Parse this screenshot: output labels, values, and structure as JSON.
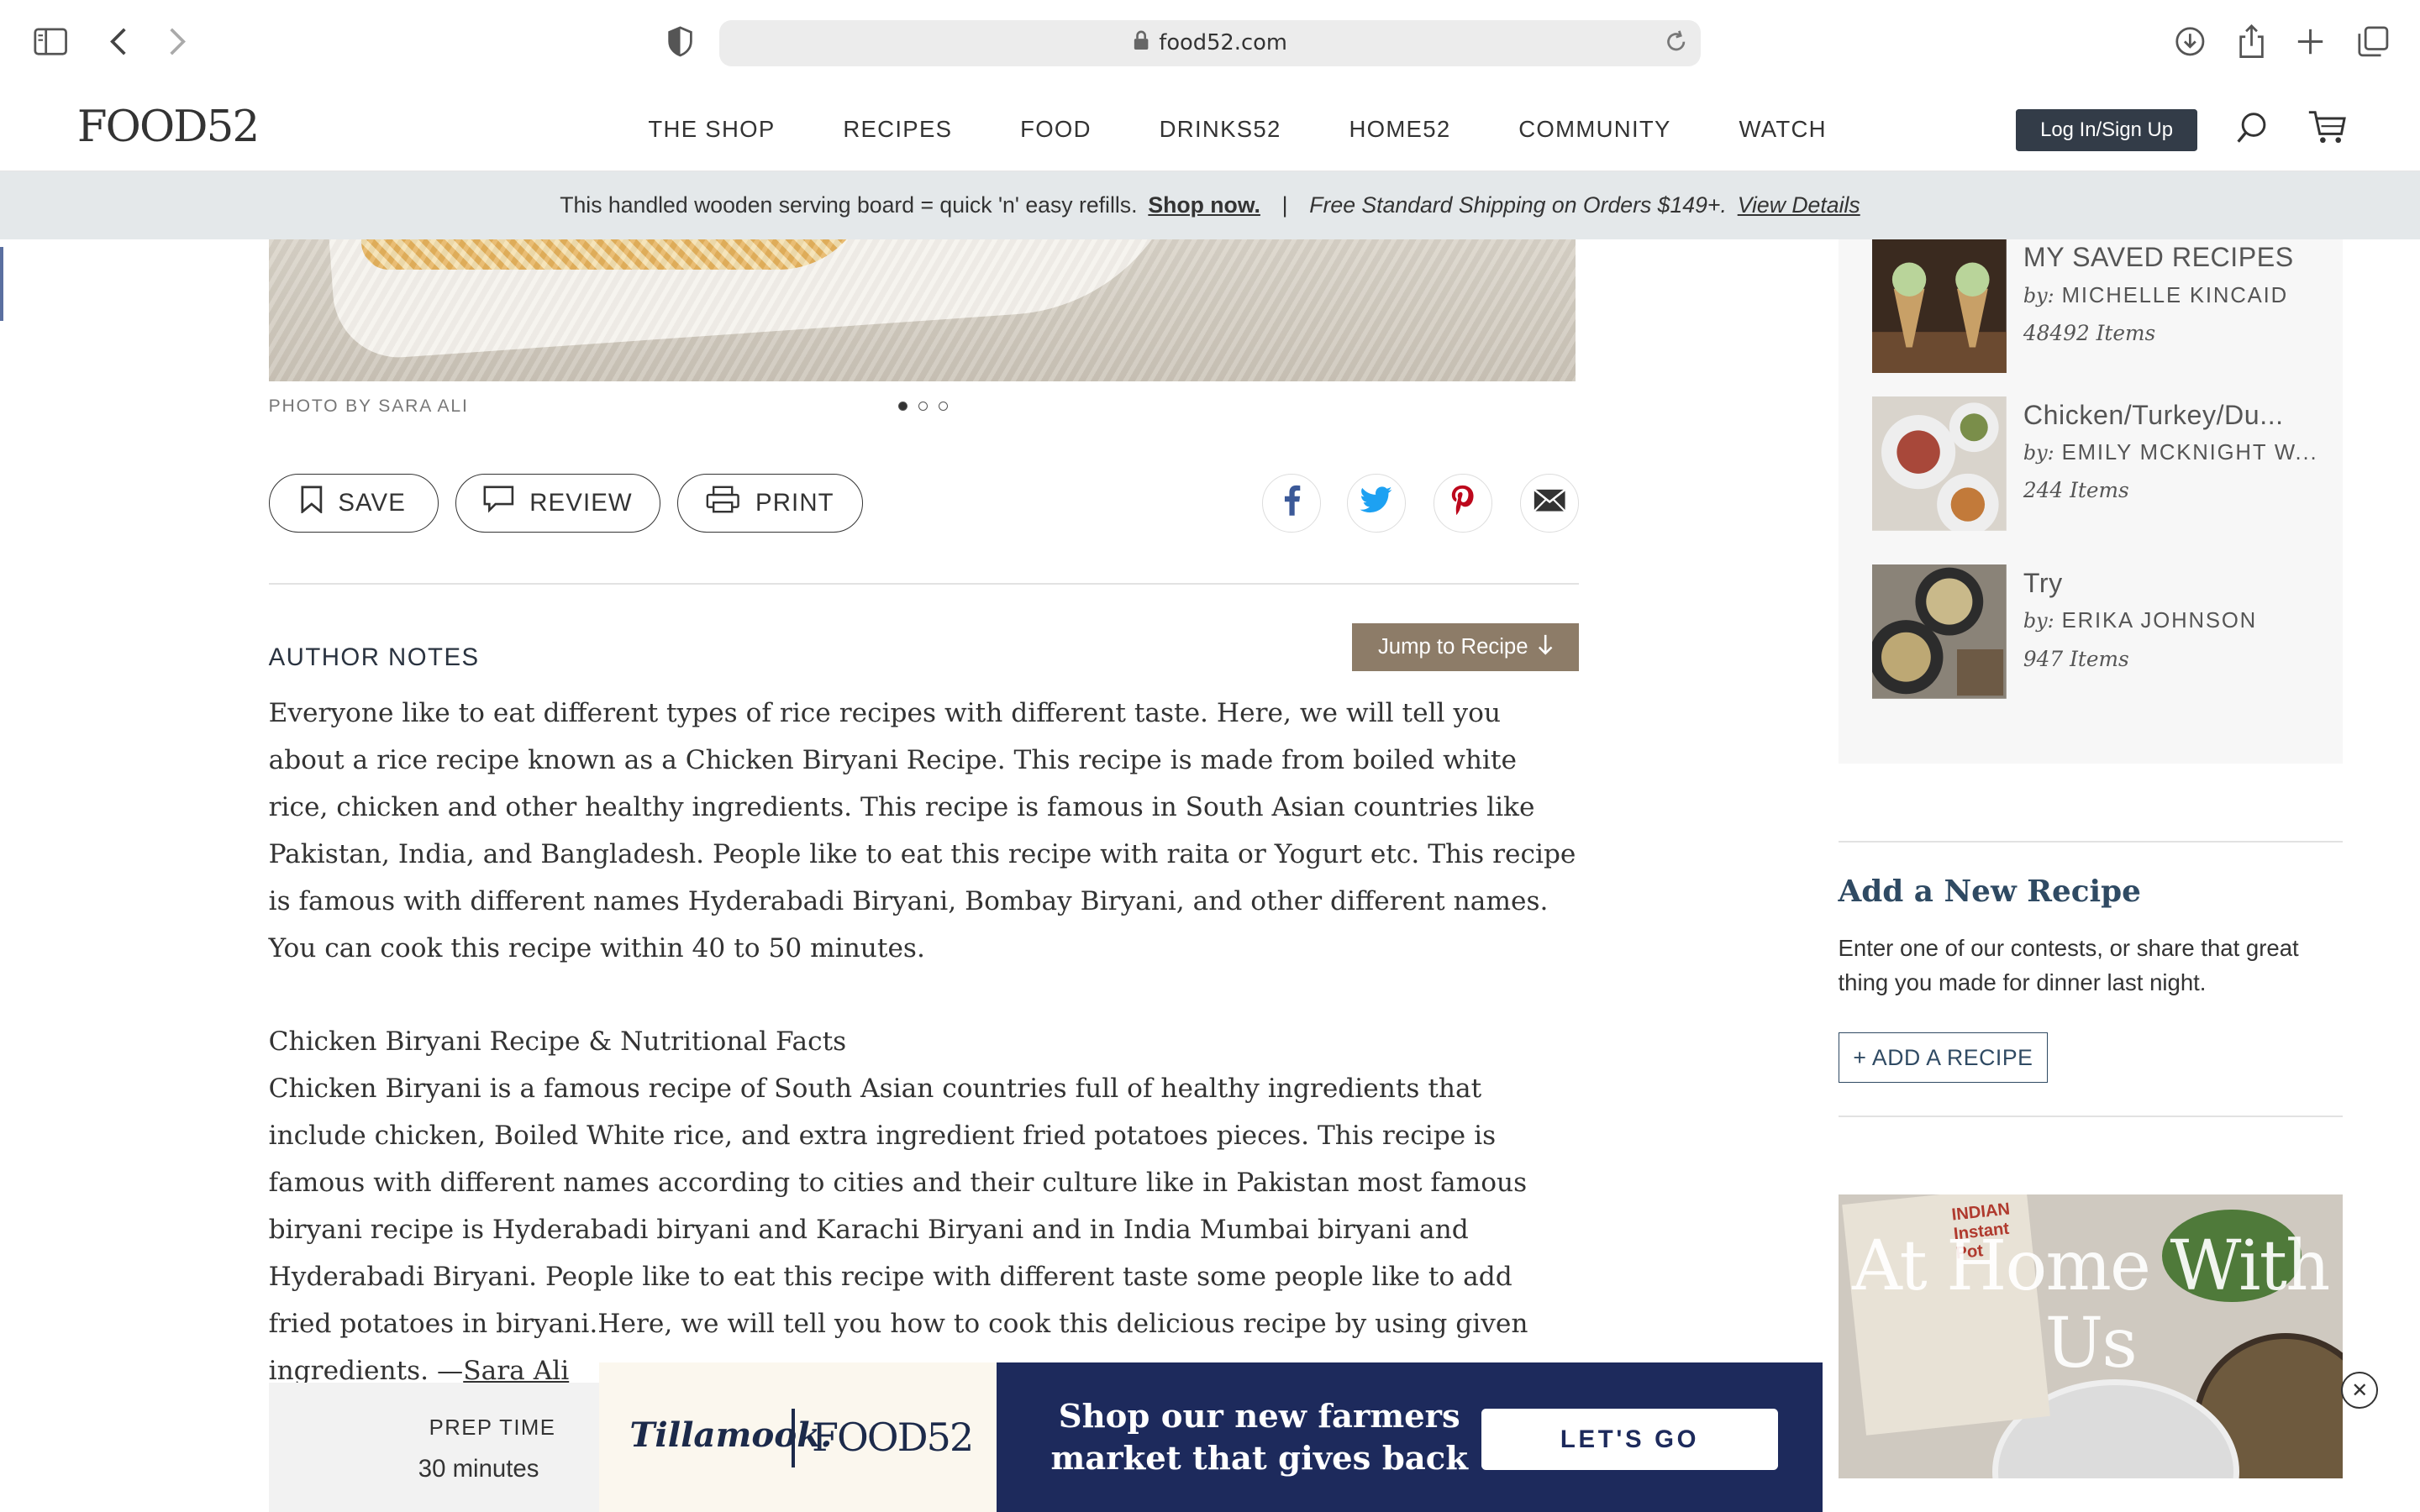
{
  "browser": {
    "url": "food52.com"
  },
  "site": {
    "logo": "FOOD52",
    "nav": [
      "THE SHOP",
      "RECIPES",
      "FOOD",
      "DRINKS52",
      "HOME52",
      "COMMUNITY",
      "WATCH"
    ],
    "login_label": "Log In/Sign Up"
  },
  "promo": {
    "text": "This handled wooden serving board = quick 'n' easy refills.",
    "link": "Shop now.",
    "separator": "|",
    "shipping": "Free Standard Shipping on Orders $149+.",
    "details_link": "View Details"
  },
  "photo": {
    "credit": "PHOTO BY SARA ALI",
    "slide_count": 3,
    "active_slide": 1
  },
  "actions": {
    "save": "SAVE",
    "review": "REVIEW",
    "print": "PRINT"
  },
  "share_icons": [
    "facebook-icon",
    "twitter-icon",
    "pinterest-icon",
    "email-icon"
  ],
  "author_notes": {
    "heading": "AUTHOR NOTES",
    "jump_label": "Jump to Recipe",
    "para1": "Everyone like to eat different types of rice recipes with different taste. Here, we will tell you about a rice recipe known as a Chicken Biryani Recipe. This recipe is made from boiled white rice, chicken and other healthy ingredients. This recipe is famous in South Asian countries like Pakistan, India, and Bangladesh. People like to eat this recipe with raita or Yogurt etc. This recipe is famous with different names Hyderabadi Biryani, Bombay Biryani, and other different names. You can cook this recipe within 40 to 50 minutes.",
    "subheading": "Chicken Biryani Recipe & Nutritional Facts",
    "para2": "Chicken Biryani is a famous recipe of South Asian countries full of healthy ingredients that include chicken, Boiled White rice, and extra ingredient fried potatoes pieces. This recipe is famous with different names according to cities and their culture like in Pakistan most famous biryani recipe is Hyderabadi biryani and Karachi Biryani and in India Mumbai biryani and Hyderabadi Biryani. People like to eat this recipe with different taste some people like to add fried potatoes in biryani.Here, we will tell you how to cook this delicious recipe by using given ingredients. —",
    "author": "Sara Ali"
  },
  "prep": {
    "label": "PREP TIME",
    "value": "30 minutes"
  },
  "saved": [
    {
      "title": "MY SAVED RECIPES",
      "by_label": "by:",
      "by": "MICHELLE KINCAID",
      "count": "48492 Items"
    },
    {
      "title": "Chicken/Turkey/Du...",
      "by_label": "by:",
      "by": "EMILY MCKNIGHT W...",
      "count": "244 Items"
    },
    {
      "title": "Try",
      "by_label": "by:",
      "by": "ERIKA JOHNSON",
      "count": "947 Items"
    }
  ],
  "add_recipe": {
    "heading": "Add a New Recipe",
    "description": "Enter one of our contests, or share that great thing you made for dinner last night.",
    "button": "+ ADD A RECIPE"
  },
  "side_ad": {
    "headline": "At Home With Us",
    "book_title": "INDIAN Instant Pot",
    "close": "✕"
  },
  "bottom_ad": {
    "brand": "Tillamook.",
    "partner": "FOOD52",
    "message": "Shop our new farmers market that gives back",
    "cta": "LET'S GO"
  },
  "colors": {
    "login_bg": "#333c48",
    "jump_bg": "#8d7c68",
    "promo_bg": "#e4e8ea",
    "accent_blue": "#2f4a63",
    "ad_navy": "#1d2a5c"
  }
}
